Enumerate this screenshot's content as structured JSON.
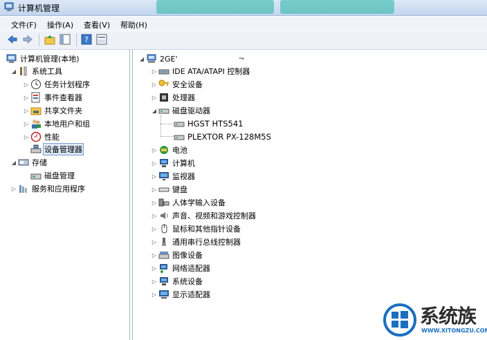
{
  "window": {
    "title": "计算机管理"
  },
  "menu": [
    "文件(F)",
    "操作(A)",
    "查看(V)",
    "帮助(H)"
  ],
  "toolbar": {
    "icons": [
      "back-arrow-icon",
      "forward-arrow-icon",
      "up-folder-icon",
      "show-hide-tree-icon",
      "help-icon",
      "properties-icon"
    ]
  },
  "left_tree": {
    "root": "计算机管理(本地)",
    "system_tools": "系统工具",
    "task_scheduler": "任务计划程序",
    "event_viewer": "事件查看器",
    "shared_folders": "共享文件夹",
    "local_users": "本地用户和组",
    "performance": "性能",
    "device_manager": "设备管理器",
    "storage": "存储",
    "disk_management": "磁盘管理",
    "services": "服务和应用程序"
  },
  "device_tree": {
    "computer": "2GE'",
    "categories": [
      "IDE ATA/ATAPI 控制器",
      "安全设备",
      "处理器",
      "磁盘驱动器",
      "电池",
      "计算机",
      "监视器",
      "键盘",
      "人体学输入设备",
      "声音、视频和游戏控制器",
      "鼠标和其他指针设备",
      "通用串行总线控制器",
      "图像设备",
      "网络适配器",
      "系统设备",
      "显示适配器"
    ],
    "disks": [
      "HGST HTS541",
      "PLEXTOR PX-128M5S"
    ]
  },
  "watermark": {
    "brand": "系统族",
    "url": "WWW.XITONGZU.COM"
  }
}
